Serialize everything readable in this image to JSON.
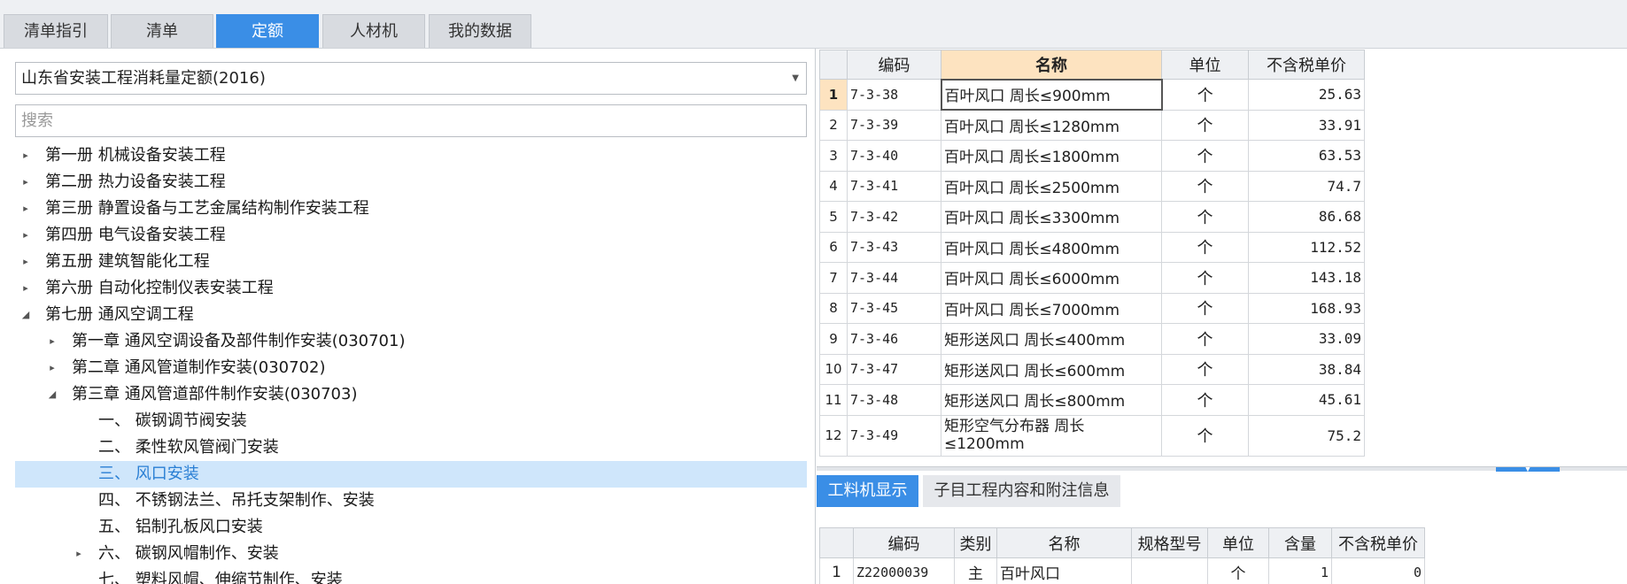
{
  "tabs": [
    "清单指引",
    "清单",
    "定额",
    "人材机",
    "我的数据"
  ],
  "active_tab": "定额",
  "left": {
    "library": "山东省安装工程消耗量定额(2016)",
    "search_placeholder": "搜索",
    "tree": [
      {
        "label": "第一册 机械设备安装工程",
        "toggle": "▸"
      },
      {
        "label": "第二册 热力设备安装工程",
        "toggle": "▸"
      },
      {
        "label": "第三册 静置设备与工艺金属结构制作安装工程",
        "toggle": "▸"
      },
      {
        "label": "第四册 电气设备安装工程",
        "toggle": "▸"
      },
      {
        "label": "第五册 建筑智能化工程",
        "toggle": "▸"
      },
      {
        "label": "第六册 自动化控制仪表安装工程",
        "toggle": "▸"
      },
      {
        "label": "第七册 通风空调工程",
        "toggle": "◢"
      },
      {
        "label": "第一章 通风空调设备及部件制作安装(030701)",
        "toggle": "▸"
      },
      {
        "label": "第二章 通风管道制作安装(030702)",
        "toggle": "▸"
      },
      {
        "label": "第三章 通风管道部件制作安装(030703)",
        "toggle": "◢"
      },
      {
        "label": "一、 碳钢调节阀安装",
        "toggle": ""
      },
      {
        "label": "二、 柔性软风管阀门安装",
        "toggle": ""
      },
      {
        "label": "三、 风口安装",
        "toggle": ""
      },
      {
        "label": "四、 不锈钢法兰、吊托支架制作、安装",
        "toggle": ""
      },
      {
        "label": "五、 铝制孔板风口安装",
        "toggle": ""
      },
      {
        "label": "六、 碳钢风帽制作、安装",
        "toggle": "▸"
      },
      {
        "label": "七、 塑料风帽、伸缩节制作、安装",
        "toggle": ""
      }
    ]
  },
  "quota_table": {
    "headers": {
      "code": "编码",
      "name": "名称",
      "unit": "单位",
      "price": "不含税单价"
    },
    "rows": [
      {
        "n": "1",
        "code": "7-3-38",
        "name": "百叶风口 周长≤900mm",
        "unit": "个",
        "price": "25.63"
      },
      {
        "n": "2",
        "code": "7-3-39",
        "name": "百叶风口 周长≤1280mm",
        "unit": "个",
        "price": "33.91"
      },
      {
        "n": "3",
        "code": "7-3-40",
        "name": "百叶风口 周长≤1800mm",
        "unit": "个",
        "price": "63.53"
      },
      {
        "n": "4",
        "code": "7-3-41",
        "name": "百叶风口 周长≤2500mm",
        "unit": "个",
        "price": "74.7"
      },
      {
        "n": "5",
        "code": "7-3-42",
        "name": "百叶风口 周长≤3300mm",
        "unit": "个",
        "price": "86.68"
      },
      {
        "n": "6",
        "code": "7-3-43",
        "name": "百叶风口 周长≤4800mm",
        "unit": "个",
        "price": "112.52"
      },
      {
        "n": "7",
        "code": "7-3-44",
        "name": "百叶风口 周长≤6000mm",
        "unit": "个",
        "price": "143.18"
      },
      {
        "n": "8",
        "code": "7-3-45",
        "name": "百叶风口 周长≤7000mm",
        "unit": "个",
        "price": "168.93"
      },
      {
        "n": "9",
        "code": "7-3-46",
        "name": "矩形送风口 周长≤400mm",
        "unit": "个",
        "price": "33.09"
      },
      {
        "n": "10",
        "code": "7-3-47",
        "name": "矩形送风口 周长≤600mm",
        "unit": "个",
        "price": "38.84"
      },
      {
        "n": "11",
        "code": "7-3-48",
        "name": "矩形送风口 周长≤800mm",
        "unit": "个",
        "price": "45.61"
      },
      {
        "n": "12",
        "code": "7-3-49",
        "name": "矩形空气分布器 周长≤1200mm",
        "unit": "个",
        "price": "75.2"
      }
    ]
  },
  "sub_tabs": [
    "工料机显示",
    "子目工程内容和附注信息"
  ],
  "resource_table": {
    "headers": {
      "code": "编码",
      "type": "类别",
      "name": "名称",
      "spec": "规格型号",
      "unit": "单位",
      "qty": "含量",
      "price": "不含税单价"
    },
    "rows": [
      {
        "n": "1",
        "code": "Z22000039",
        "type": "主",
        "name": "百叶风口",
        "spec": "",
        "unit": "个",
        "qty": "1",
        "price": "0"
      }
    ]
  }
}
